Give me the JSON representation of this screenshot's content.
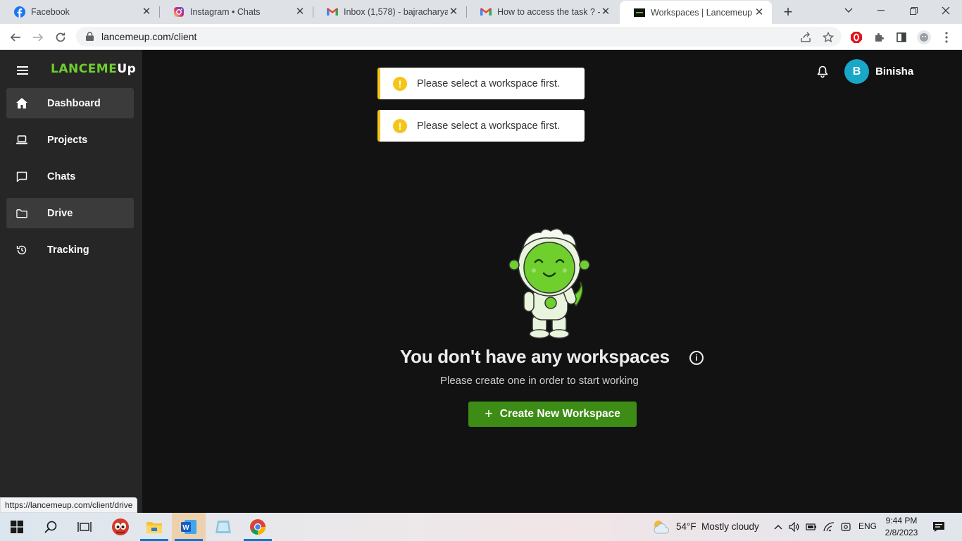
{
  "browser": {
    "tabs": [
      {
        "title": "Facebook",
        "icon": "facebook-icon"
      },
      {
        "title": "Instagram • Chats",
        "icon": "instagram-icon"
      },
      {
        "title": "Inbox (1,578) - bajracharyabi",
        "icon": "gmail-icon"
      },
      {
        "title": "How to access the task ? - bi",
        "icon": "gmail-icon"
      },
      {
        "title": "Workspaces | Lancemeup",
        "icon": "lancemeup-icon"
      }
    ],
    "active_tab": 4,
    "url": "lancemeup.com/client",
    "status_url": "https://lancemeup.com/client/drive"
  },
  "sidebar": {
    "logo_main": "LANCEME",
    "logo_up": "Up",
    "items": [
      {
        "label": "Dashboard",
        "icon": "home-icon"
      },
      {
        "label": "Projects",
        "icon": "laptop-icon"
      },
      {
        "label": "Chats",
        "icon": "chat-icon"
      },
      {
        "label": "Drive",
        "icon": "folder-icon"
      },
      {
        "label": "Tracking",
        "icon": "history-icon"
      }
    ]
  },
  "header": {
    "avatar_initial": "B",
    "username": "Binisha"
  },
  "toasts": [
    {
      "message": "Please select a workspace first."
    },
    {
      "message": "Please select a workspace first."
    }
  ],
  "empty_state": {
    "title": "You don't have any workspaces",
    "subtitle": "Please create one in order to start working",
    "button": "Create New Workspace"
  },
  "taskbar": {
    "weather_temp": "54°F",
    "weather_desc": "Mostly cloudy",
    "language": "ENG",
    "time": "9:44 PM",
    "date": "2/8/2023"
  },
  "colors": {
    "accent_green": "#3d8c15",
    "logo_green": "#6fcf2d",
    "avatar": "#19a7c7",
    "warning": "#f5c518",
    "sidebar_bg": "#262626",
    "main_bg": "#121212"
  }
}
